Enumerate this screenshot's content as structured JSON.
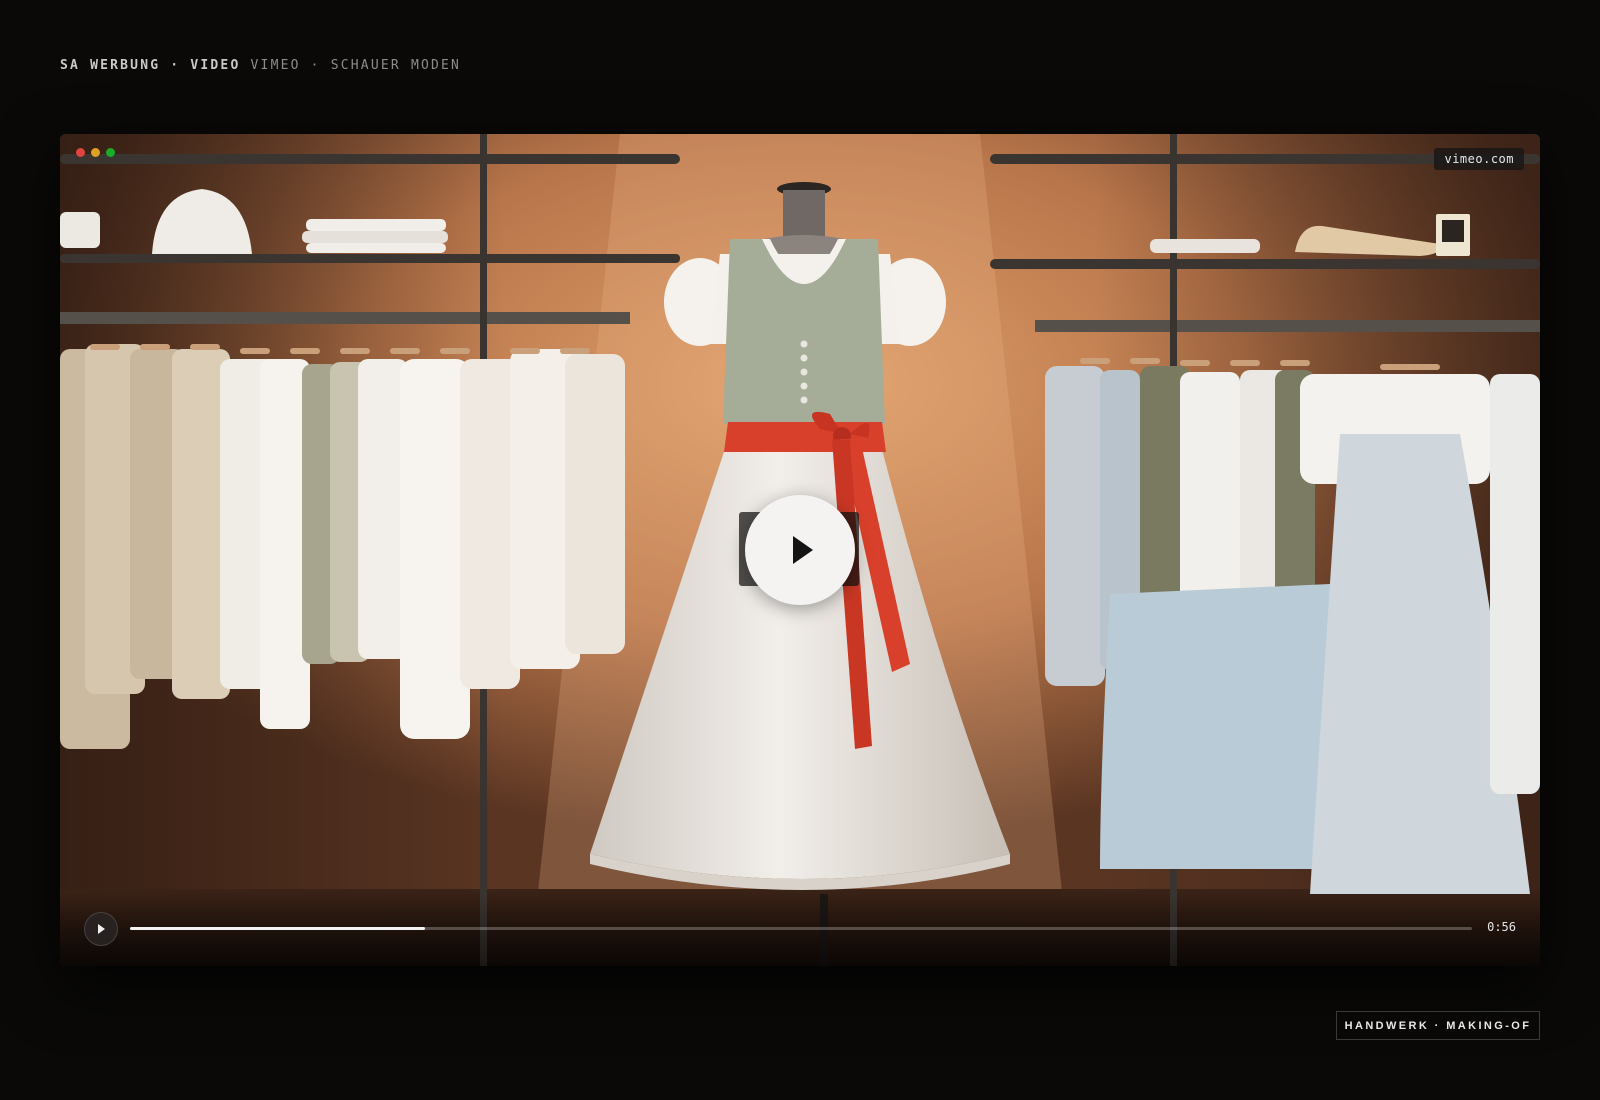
{
  "header": {
    "brand": "SA WERBUNG · VIDEO",
    "meta": "VIMEO · SCHAUER MODEN"
  },
  "player": {
    "domain": "vimeo.com",
    "time": "0:56",
    "progress": 0.22,
    "window_dots": [
      "red",
      "yellow",
      "green"
    ],
    "thumbnail": "shop interior with mannequin wearing a dirndl with red apron bow, clothing racks on both sides"
  },
  "tag": {
    "label": "HANDWERK · MAKING-OF"
  },
  "colors": {
    "background": "#0a0908",
    "accent_red": "#d9402b",
    "play_button": "#f4f3f1"
  },
  "icons": {
    "big_play": "play-icon",
    "small_play": "play-icon"
  }
}
